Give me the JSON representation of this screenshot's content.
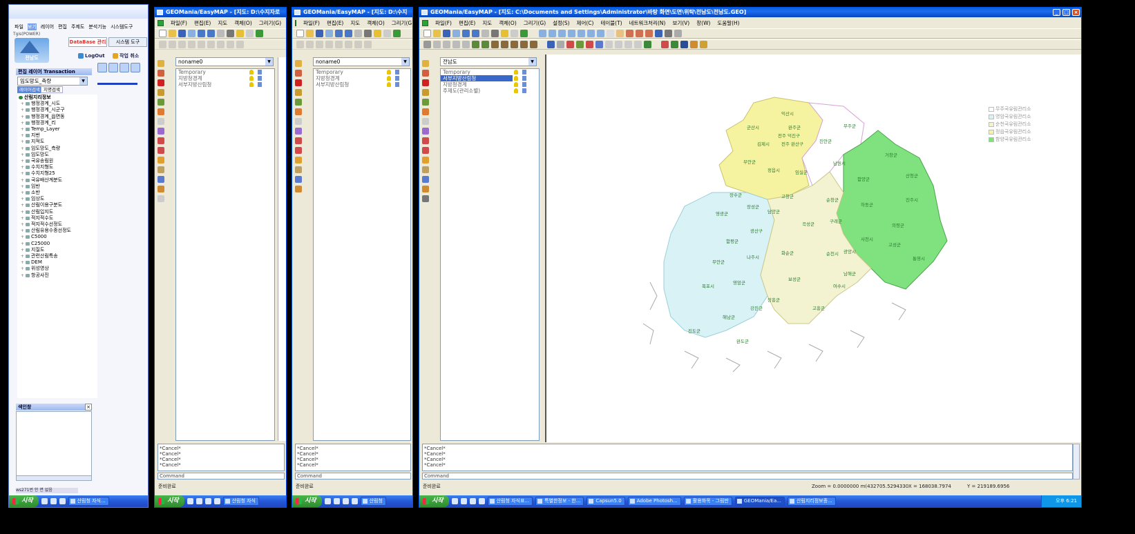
{
  "panel1": {
    "menu": [
      "파일",
      "보기",
      "레이어",
      "편집",
      "주제도",
      "분석기능",
      "시스템도구"
    ],
    "brand_sub": "Tgis(POWER)",
    "brand_name": "전남도",
    "tabs": [
      "DataBase 관리",
      "시스템 도구"
    ],
    "buttons": [
      "LogOut",
      "작업 취소"
    ],
    "side_header": "편집 레이어 Transaction",
    "layer_combo": "임도망도_측량",
    "subtabs": [
      "레이어검색",
      "지명검색"
    ],
    "tree_root": "산림지리정보",
    "tree_items": [
      "행정경계_시도",
      "행정경계_시군구",
      "행정경계_읍면동",
      "행정경계_리",
      "Temp_Layer",
      "지번",
      "지적도",
      "임도망도_측량",
      "임도망도",
      "국유송림원",
      "수치지형도",
      "수치지형25",
      "국유배산계분도",
      "임반",
      "소반",
      "임상도",
      "산림이용구분도",
      "산림입지도",
      "적지적수도",
      "적지적수선정도",
      "산림유용수종선정도",
      "C5000",
      "C25000",
      "지질도",
      "관련산림특송",
      "DEM",
      "위성영상",
      "항공사진"
    ],
    "bottom_header": "색인창",
    "status_cells": [
      "ws271번 안 면 없음"
    ],
    "taskbar": {
      "start": "시작",
      "tasks": [
        "산림청 자식..."
      ]
    }
  },
  "panel2": {
    "title": "GEOMania/EasyMAP - [지도: D:\\수지자로",
    "menu": [
      "파일(F)",
      "편집(E)",
      "지도",
      "객체(O)",
      "그리기(G)"
    ],
    "combo": "noname0",
    "layers": [
      "Temporary",
      "지방청경계",
      "서부지방산림청"
    ],
    "cmd": [
      "*Cancel*",
      "*Cancel*",
      "*Cancel*",
      "*Cancel*"
    ],
    "command_label": "Command",
    "status": "준비완료",
    "taskbar": {
      "start": "시작",
      "tasks": [
        "산림청 자식"
      ]
    }
  },
  "panel3": {
    "title": "GEOMania/EasyMAP - [지도: D:\\수지",
    "menu": [
      "파일(F)",
      "편집(E)",
      "지도",
      "객체(O)",
      "그리기(G)"
    ],
    "combo": "noname0",
    "layers": [
      "Temporary",
      "지방청경계",
      "서부지방산림청"
    ],
    "cmd": [
      "*Cancel*",
      "*Cancel*",
      "*Cancel*",
      "*Cancel*"
    ],
    "command_label": "Command",
    "status": "준비완료",
    "taskbar": {
      "start": "시작",
      "tasks": [
        "산림청"
      ]
    }
  },
  "panel4": {
    "title": "GEOMania/EasyMAP - [지도: C:\\Documents and Settings\\Administrator\\바탕 화면\\도면\\위탁\\전남도\\전남도.GEO]",
    "menu": [
      "파일(F)",
      "편집(E)",
      "지도",
      "객체(O)",
      "그리기(G)",
      "설정(S)",
      "제어(C)",
      "테이블(T)",
      "네트워크처리(N)",
      "보기(V)",
      "창(W)",
      "도움말(H)"
    ],
    "combo": "전남도",
    "layers": [
      "Temporary",
      "서부지방산림청",
      "지방청경계",
      "주제도(관리소별)"
    ],
    "legend": [
      {
        "label": "무주국유림관리소",
        "color": "#ffffff"
      },
      {
        "label": "영암국유림관리소",
        "color": "#d9f2f6"
      },
      {
        "label": "순천국유림관리소",
        "color": "#f3f3d2"
      },
      {
        "label": "정읍국유림관리소",
        "color": "#f6f3a0"
      },
      {
        "label": "함양국유림관리소",
        "color": "#7fe27f"
      }
    ],
    "map_labels": [
      "익산시",
      "군산시",
      "완주군",
      "전주 덕진구",
      "전주 완산구",
      "김제시",
      "진안군",
      "무주군",
      "부안군",
      "정읍시",
      "임실군",
      "장수군",
      "고창군",
      "순창군",
      "남원시",
      "거창군",
      "함양군",
      "산청군",
      "하동군",
      "진주시",
      "의령군",
      "사천시",
      "고성군",
      "통영시",
      "남해군",
      "담양군",
      "장성군",
      "영광군",
      "곡성군",
      "구례군",
      "광산구",
      "화순군",
      "나주시",
      "함평군",
      "무안군",
      "순천시",
      "광양시",
      "보성군",
      "영암군",
      "장흥군",
      "여수시",
      "목포시",
      "해남군",
      "강진군",
      "고흥군",
      "완도군",
      "진도군"
    ],
    "cmd": [
      "*Cancel*",
      "*Cancel*",
      "*Cancel*",
      "*Cancel*"
    ],
    "command_label": "Command",
    "status_left": "준비완료",
    "status_zoom": "Zoom = 0.0000000 m(432705.5294330",
    "status_x": "X = 168038.7974",
    "status_y": "Y = 219189.6956",
    "taskbar": {
      "start": "시작",
      "tasks": [
        "산림청 자식표...",
        "특별한정보 - 한...",
        "Capsun5.0",
        "Adobe Photosh...",
        "활용화목 - 그림판",
        "GEOMania/Ea...",
        "산림지리정보종..."
      ],
      "clock": "오후 6:21"
    }
  }
}
